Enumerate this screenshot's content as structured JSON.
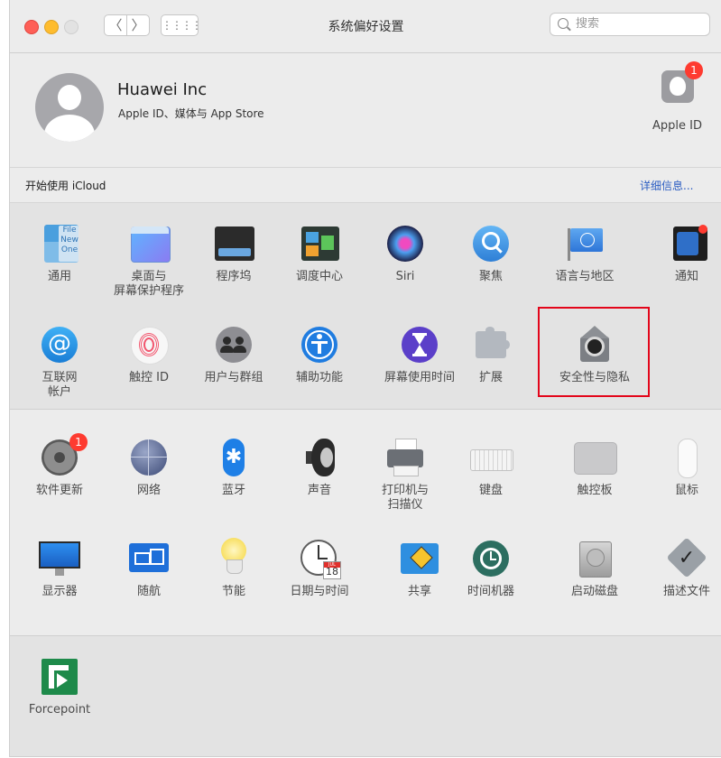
{
  "window": {
    "title": "系统偏好设置"
  },
  "toolbar": {
    "back": "〈",
    "forward": "〉",
    "grid": "⋮⋮⋮⋮",
    "search_placeholder": "搜索"
  },
  "account": {
    "name": "Huawei Inc",
    "subtitle": "Apple ID、媒体与 App Store",
    "apple_id_label": "Apple ID",
    "badge_count": "1"
  },
  "icloud": {
    "label": "开始使用 iCloud",
    "details": "详细信息..."
  },
  "section1": {
    "row1": [
      {
        "label": "通用",
        "icon": "general-icon"
      },
      {
        "label": "桌面与\n屏幕保护程序",
        "icon": "desktop-screensaver-icon"
      },
      {
        "label": "程序坞",
        "icon": "dock-icon"
      },
      {
        "label": "调度中心",
        "icon": "mission-control-icon"
      },
      {
        "label": "Siri",
        "icon": "siri-icon"
      },
      {
        "label": "聚焦",
        "icon": "spotlight-icon"
      },
      {
        "label": "语言与地区",
        "icon": "language-region-icon"
      },
      {
        "label": "通知",
        "icon": "notifications-icon"
      }
    ],
    "row2": [
      {
        "label": "互联网\n帐户",
        "icon": "internet-accounts-icon"
      },
      {
        "label": "触控 ID",
        "icon": "touch-id-icon"
      },
      {
        "label": "用户与群组",
        "icon": "users-groups-icon"
      },
      {
        "label": "辅助功能",
        "icon": "accessibility-icon"
      },
      {
        "label": "屏幕使用时间",
        "icon": "screen-time-icon"
      },
      {
        "label": "扩展",
        "icon": "extensions-icon"
      },
      {
        "label": "安全性与隐私",
        "icon": "security-privacy-icon"
      }
    ]
  },
  "section2": {
    "row1": [
      {
        "label": "软件更新",
        "icon": "software-update-icon",
        "badge": "1"
      },
      {
        "label": "网络",
        "icon": "network-icon"
      },
      {
        "label": "蓝牙",
        "icon": "bluetooth-icon"
      },
      {
        "label": "声音",
        "icon": "sound-icon"
      },
      {
        "label": "打印机与\n扫描仪",
        "icon": "printers-scanners-icon"
      },
      {
        "label": "键盘",
        "icon": "keyboard-icon"
      },
      {
        "label": "触控板",
        "icon": "trackpad-icon"
      },
      {
        "label": "鼠标",
        "icon": "mouse-icon"
      }
    ],
    "row2": [
      {
        "label": "显示器",
        "icon": "displays-icon"
      },
      {
        "label": "随航",
        "icon": "sidecar-icon"
      },
      {
        "label": "节能",
        "icon": "energy-saver-icon"
      },
      {
        "label": "日期与时间",
        "icon": "date-time-icon",
        "date_text": "JUL",
        "day_text": "18"
      },
      {
        "label": "共享",
        "icon": "sharing-icon"
      },
      {
        "label": "时间机器",
        "icon": "time-machine-icon"
      },
      {
        "label": "启动磁盘",
        "icon": "startup-disk-icon"
      },
      {
        "label": "描述文件",
        "icon": "profiles-icon"
      }
    ]
  },
  "section3": {
    "items": [
      {
        "label": "Forcepoint",
        "icon": "forcepoint-icon"
      }
    ]
  },
  "general_icon_text": [
    "File",
    "New",
    "One"
  ],
  "colors": {
    "highlight": "#e3061b",
    "link": "#2a5cc2",
    "badge": "#fe3b30"
  }
}
